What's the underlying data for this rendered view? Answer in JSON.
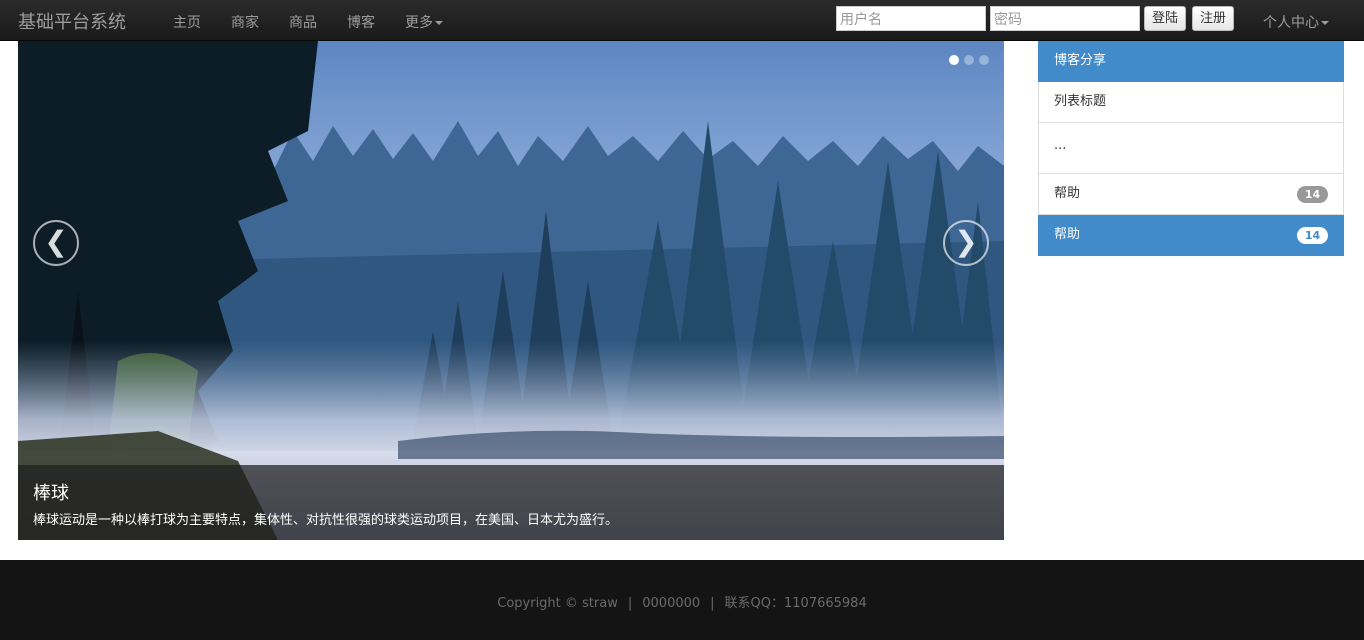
{
  "navbar": {
    "brand": "基础平台系统",
    "links": [
      "主页",
      "商家",
      "商品",
      "博客"
    ],
    "more_label": "更多",
    "username_placeholder": "用户名",
    "password_placeholder": "密码",
    "login_label": "登陆",
    "register_label": "注册",
    "user_center_label": "个人中心"
  },
  "carousel": {
    "caption_title": "棒球",
    "caption_text": "棒球运动是一种以棒打球为主要特点，集体性、对抗性很强的球类运动项目，在美国、日本尤为盛行。",
    "prev_glyph": "❮",
    "next_glyph": "❯",
    "slide_count": 3,
    "active_index": 0
  },
  "sidebar": {
    "header": "博客分享",
    "items": [
      {
        "label": "列表标题"
      },
      {
        "label": "..."
      },
      {
        "label": "帮助",
        "badge": "14"
      },
      {
        "label": "帮助",
        "badge": "14"
      }
    ]
  },
  "footer": {
    "copyright": "Copyright © straw",
    "number": "0000000",
    "qq": "联系QQ：1107665984"
  },
  "colors": {
    "navbar_bg": "#222222",
    "accent": "#428bca",
    "footer_bg": "#141414"
  }
}
